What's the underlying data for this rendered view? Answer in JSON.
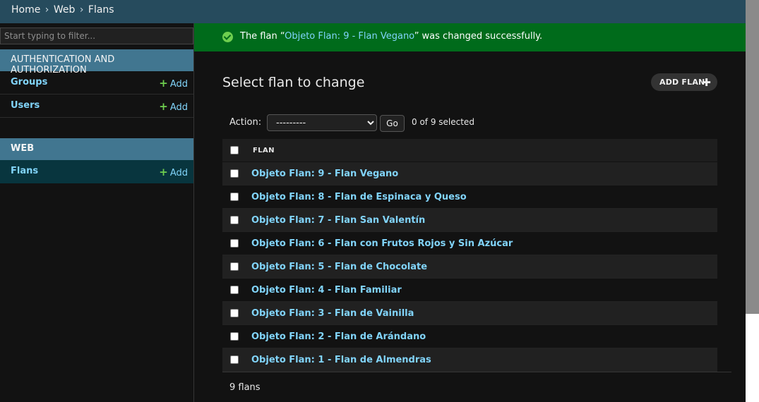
{
  "breadcrumbs": {
    "home": "Home",
    "sep": "›",
    "app": "Web",
    "model": "Flans"
  },
  "sidebar": {
    "filter_placeholder": "Start typing to filter...",
    "apps": [
      {
        "caption": "AUTHENTICATION AND AUTHORIZATION",
        "models": [
          {
            "name": "Groups",
            "add": "Add"
          },
          {
            "name": "Users",
            "add": "Add"
          }
        ]
      },
      {
        "caption": "WEB",
        "models": [
          {
            "name": "Flans",
            "add": "Add"
          }
        ]
      }
    ],
    "add_icon": "plus-icon"
  },
  "message": {
    "prefix": "The flan “",
    "object": "Objeto Flan: 9 - Flan Vegano",
    "suffix": "” was changed successfully.",
    "icon": "check-circle-icon"
  },
  "main": {
    "title": "Select flan to change",
    "add_button": "ADD FLAN",
    "action_label": "Action:",
    "action_value": "---------",
    "go": "Go",
    "selected": "0 of 9 selected",
    "column_header": "FLAN",
    "rows": [
      "Objeto Flan: 9 - Flan Vegano",
      "Objeto Flan: 8 - Flan de Espinaca y Queso",
      "Objeto Flan: 7 - Flan San Valentín",
      "Objeto Flan: 6 - Flan con Frutos Rojos y Sin Azúcar",
      "Objeto Flan: 5 - Flan de Chocolate",
      "Objeto Flan: 4 - Flan Familiar",
      "Objeto Flan: 3 - Flan de Vainilla",
      "Objeto Flan: 2 - Flan de Arándano",
      "Objeto Flan: 1 - Flan de Almendras"
    ],
    "paginator": "9 flans"
  },
  "colors": {
    "header": "#264b5d",
    "caption": "#417690",
    "success": "#006b1b",
    "link": "#81d4fa",
    "add_green": "#6fcf4f"
  }
}
